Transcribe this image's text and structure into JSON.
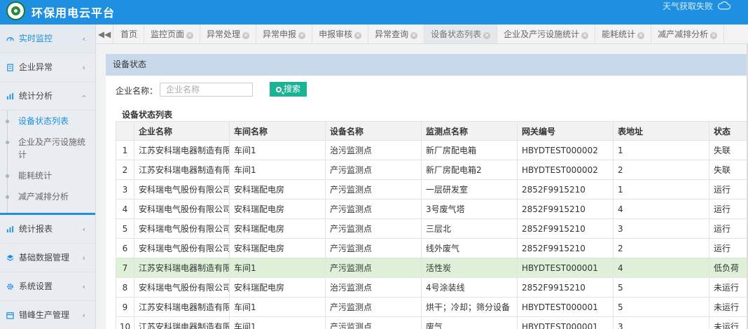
{
  "header": {
    "title": "环保用电云平台",
    "weather_text": "天气获取失败"
  },
  "sidebar": {
    "items": [
      {
        "label": "实时监控",
        "icon": "dashboard-icon"
      },
      {
        "label": "企业异常",
        "icon": "document-icon"
      },
      {
        "label": "统计分析",
        "icon": "bar-chart-icon"
      },
      {
        "label": "统计报表",
        "icon": "bar-chart-icon"
      },
      {
        "label": "基础数据管理",
        "icon": "layers-icon"
      },
      {
        "label": "系统设置",
        "icon": "gear-icon"
      },
      {
        "label": "错峰生产管理",
        "icon": "calendar-icon"
      }
    ],
    "submenu": [
      {
        "label": "设备状态列表"
      },
      {
        "label": "企业及产污设施统计"
      },
      {
        "label": "能耗统计"
      },
      {
        "label": "减产减排分析"
      }
    ]
  },
  "tabs": [
    {
      "label": "首页"
    },
    {
      "label": "监控页面"
    },
    {
      "label": "异常处理"
    },
    {
      "label": "异常申报"
    },
    {
      "label": "申报审核"
    },
    {
      "label": "异常查询"
    },
    {
      "label": "设备状态列表"
    },
    {
      "label": "企业及产污设施统计"
    },
    {
      "label": "能耗统计"
    },
    {
      "label": "减产减排分析"
    }
  ],
  "panel": {
    "title": "设备状态",
    "search_label": "企业名称：",
    "search_placeholder": "企业名称",
    "search_button": "搜索",
    "list_title": "设备状态列表"
  },
  "table": {
    "columns": [
      "企业名称",
      "车间名称",
      "设备名称",
      "监测点名称",
      "网关编号",
      "表地址",
      "状态"
    ],
    "rows": [
      {
        "idx": "1",
        "company": "江苏安科瑞电器制造有限公司",
        "workshop": "车间1",
        "device": "治污监测点",
        "point": "新厂房配电箱",
        "gateway": "HBYDTEST000002",
        "addr": "1",
        "status": "失联"
      },
      {
        "idx": "2",
        "company": "江苏安科瑞电器制造有限公司",
        "workshop": "车间1",
        "device": "产污监测点",
        "point": "新厂房配电箱2",
        "gateway": "HBYDTEST000002",
        "addr": "2",
        "status": "失联"
      },
      {
        "idx": "3",
        "company": "安科瑞电气股份有限公司",
        "workshop": "安科瑞配电房",
        "device": "产污监测点",
        "point": "一层研发室",
        "gateway": "2852F9915210",
        "addr": "1",
        "status": "运行"
      },
      {
        "idx": "4",
        "company": "安科瑞电气股份有限公司",
        "workshop": "安科瑞配电房",
        "device": "产污监测点",
        "point": "3号废气塔",
        "gateway": "2852F9915210",
        "addr": "4",
        "status": "运行"
      },
      {
        "idx": "5",
        "company": "安科瑞电气股份有限公司",
        "workshop": "安科瑞配电房",
        "device": "产污监测点",
        "point": "三层北",
        "gateway": "2852F9915210",
        "addr": "3",
        "status": "运行"
      },
      {
        "idx": "6",
        "company": "安科瑞电气股份有限公司",
        "workshop": "安科瑞配电房",
        "device": "产污监测点",
        "point": "线外废气",
        "gateway": "2852F9915210",
        "addr": "2",
        "status": "运行"
      },
      {
        "idx": "7",
        "company": "江苏安科瑞电器制造有限公司",
        "workshop": "车间1",
        "device": "产污监测点",
        "point": "活性炭",
        "gateway": "HBYDTEST000001",
        "addr": "4",
        "status": "低负荷"
      },
      {
        "idx": "8",
        "company": "安科瑞电气股份有限公司",
        "workshop": "安科瑞配电房",
        "device": "治污监测点",
        "point": "4号涂装线",
        "gateway": "2852F9915210",
        "addr": "5",
        "status": "未运行"
      },
      {
        "idx": "9",
        "company": "江苏安科瑞电器制造有限公司",
        "workshop": "车间1",
        "device": "产污监测点",
        "point": "烘干；冷却；筛分设备",
        "gateway": "HBYDTEST000001",
        "addr": "5",
        "status": "未运行"
      },
      {
        "idx": "10",
        "company": "江苏安科瑞电器制造有限公司",
        "workshop": "车间1",
        "device": "产污监测点",
        "point": "废气",
        "gateway": "HBYDTEST000001",
        "addr": "3",
        "status": "未运行"
      }
    ]
  },
  "colors": {
    "header": "#1e8fe1",
    "accent": "#1e8fe1",
    "search_button": "#1ab394",
    "highlight_row": "#dff0d8",
    "panel_head": "#c7d9eb"
  }
}
